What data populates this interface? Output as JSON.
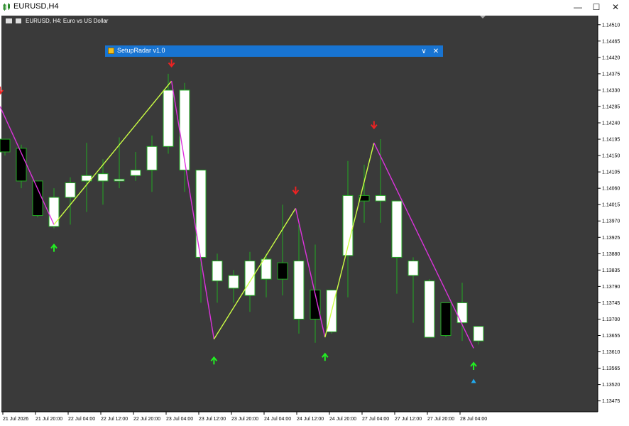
{
  "window": {
    "title": "EURUSD,H4",
    "minimize_icon": "minimize-icon",
    "maximize_icon": "maximize-icon",
    "close_icon": "close-icon"
  },
  "chart_label": "EURUSD, H4:  Euro vs US Dollar",
  "panel": {
    "title": "SetupRadar  v1.0",
    "collapse_glyph": "∨",
    "close_glyph": "✕"
  },
  "colors": {
    "background": "#3a3a3a",
    "bull_candle": "#ffffff",
    "bear_candle": "#000000",
    "candle_border": "#22aa22",
    "wick": "#22aa22",
    "zigzag_up": "#ccff44",
    "zigzag_down": "#dd33dd",
    "arrow_up": "#22ee22",
    "arrow_down": "#ee2222",
    "marker": "#22aaee",
    "panel": "#1874d2"
  },
  "chart_data": {
    "type": "candlestick",
    "symbol": "EURUSD",
    "timeframe": "H4",
    "ylim": [
      1.13445,
      1.14535
    ],
    "y_ticks": [
      "1.14510",
      "1.14465",
      "1.14420",
      "1.14375",
      "1.14330",
      "1.14285",
      "1.14240",
      "1.14195",
      "1.14150",
      "1.14105",
      "1.14060",
      "1.14015",
      "1.13970",
      "1.13925",
      "1.13880",
      "1.13835",
      "1.13790",
      "1.13745",
      "1.13700",
      "1.13655",
      "1.13610",
      "1.13565",
      "1.13520",
      "1.13475"
    ],
    "x_ticks": [
      "21 Jul 2026",
      "21 Jul 20:00",
      "22 Jul 04:00",
      "22 Jul 12:00",
      "22 Jul 20:00",
      "23 Jul 04:00",
      "23 Jul 12:00",
      "23 Jul 20:00",
      "24 Jul 04:00",
      "24 Jul 12:00",
      "24 Jul 20:00",
      "27 Jul 04:00",
      "27 Jul 12:00",
      "27 Jul 20:00",
      "28 Jul 04:00"
    ],
    "candles": [
      {
        "o": 1.14195,
        "h": 1.14195,
        "l": 1.1415,
        "c": 1.1416
      },
      {
        "o": 1.1417,
        "h": 1.1418,
        "l": 1.1406,
        "c": 1.1408
      },
      {
        "o": 1.1408,
        "h": 1.1408,
        "l": 1.1398,
        "c": 1.13985
      },
      {
        "o": 1.13955,
        "h": 1.1406,
        "l": 1.1395,
        "c": 1.14035
      },
      {
        "o": 1.14035,
        "h": 1.1409,
        "l": 1.1396,
        "c": 1.14075
      },
      {
        "o": 1.1408,
        "h": 1.14185,
        "l": 1.13995,
        "c": 1.14095
      },
      {
        "o": 1.1408,
        "h": 1.1414,
        "l": 1.14015,
        "c": 1.141
      },
      {
        "o": 1.1408,
        "h": 1.142,
        "l": 1.1406,
        "c": 1.14085
      },
      {
        "o": 1.14095,
        "h": 1.1416,
        "l": 1.1408,
        "c": 1.1411
      },
      {
        "o": 1.1411,
        "h": 1.14205,
        "l": 1.1405,
        "c": 1.14175
      },
      {
        "o": 1.14175,
        "h": 1.14375,
        "l": 1.14155,
        "c": 1.1433
      },
      {
        "o": 1.1411,
        "h": 1.1435,
        "l": 1.1405,
        "c": 1.1433
      },
      {
        "o": 1.1387,
        "h": 1.1411,
        "l": 1.13745,
        "c": 1.1411
      },
      {
        "o": 1.13805,
        "h": 1.1388,
        "l": 1.13745,
        "c": 1.1386
      },
      {
        "o": 1.13785,
        "h": 1.13835,
        "l": 1.13745,
        "c": 1.1382
      },
      {
        "o": 1.13765,
        "h": 1.13885,
        "l": 1.1372,
        "c": 1.1386
      },
      {
        "o": 1.1381,
        "h": 1.1388,
        "l": 1.1376,
        "c": 1.13865
      },
      {
        "o": 1.13855,
        "h": 1.14015,
        "l": 1.13765,
        "c": 1.1381
      },
      {
        "o": 1.137,
        "h": 1.1396,
        "l": 1.1366,
        "c": 1.1386
      },
      {
        "o": 1.1378,
        "h": 1.13905,
        "l": 1.13635,
        "c": 1.137
      },
      {
        "o": 1.13665,
        "h": 1.1378,
        "l": 1.1366,
        "c": 1.1378
      },
      {
        "o": 1.13875,
        "h": 1.14135,
        "l": 1.1376,
        "c": 1.1404
      },
      {
        "o": 1.1404,
        "h": 1.14125,
        "l": 1.13965,
        "c": 1.14025
      },
      {
        "o": 1.14025,
        "h": 1.14195,
        "l": 1.13965,
        "c": 1.1404
      },
      {
        "o": 1.1387,
        "h": 1.14025,
        "l": 1.1377,
        "c": 1.14025
      },
      {
        "o": 1.1382,
        "h": 1.1387,
        "l": 1.1369,
        "c": 1.1386
      },
      {
        "o": 1.1365,
        "h": 1.1381,
        "l": 1.1365,
        "c": 1.13805
      },
      {
        "o": 1.13745,
        "h": 1.13745,
        "l": 1.1365,
        "c": 1.13655
      },
      {
        "o": 1.1369,
        "h": 1.138,
        "l": 1.1364,
        "c": 1.13745
      },
      {
        "o": 1.1364,
        "h": 1.1368,
        "l": 1.1363,
        "c": 1.1368
      }
    ],
    "zigzag": [
      {
        "i": -0.3,
        "p": 1.14285
      },
      {
        "i": 3,
        "p": 1.1396
      },
      {
        "i": 10.2,
        "p": 1.14355
      },
      {
        "i": 12.8,
        "p": 1.13645
      },
      {
        "i": 17.8,
        "p": 1.14005
      },
      {
        "i": 19.6,
        "p": 1.1365
      },
      {
        "i": 22.6,
        "p": 1.14185
      },
      {
        "i": 28.7,
        "p": 1.1362
      }
    ],
    "arrows_down": [
      {
        "i": -0.3,
        "p": 1.1433
      },
      {
        "i": 10.2,
        "p": 1.14405
      },
      {
        "i": 17.8,
        "p": 1.14055
      },
      {
        "i": 22.6,
        "p": 1.14235
      }
    ],
    "arrows_up": [
      {
        "i": 3,
        "p": 1.13895
      },
      {
        "i": 12.8,
        "p": 1.13585
      },
      {
        "i": 19.6,
        "p": 1.13595
      },
      {
        "i": 28.7,
        "p": 1.1357
      }
    ],
    "markers": [
      {
        "i": 28.7,
        "p": 1.1353
      }
    ]
  }
}
